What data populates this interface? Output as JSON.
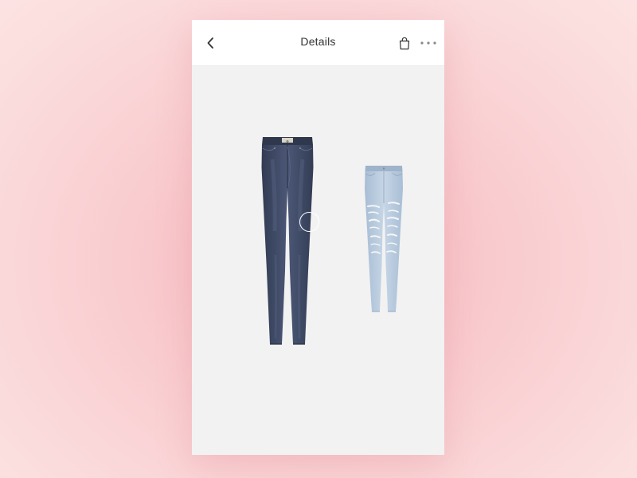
{
  "header": {
    "title": "Details",
    "back_icon": "chevron-left-icon",
    "bag_icon": "shopping-bag-icon",
    "more_icon": "more-horizontal-icon"
  },
  "products": [
    {
      "kind": "dark-wash-skinny-jeans",
      "color": "#3f4a63"
    },
    {
      "kind": "light-wash-ripped-skinny-jeans",
      "color": "#b7cade"
    }
  ],
  "theme": {
    "background_accent": "#f6b7bd",
    "card_background": "#f2f2f2",
    "header_background": "#ffffff",
    "text_color": "#333333"
  }
}
